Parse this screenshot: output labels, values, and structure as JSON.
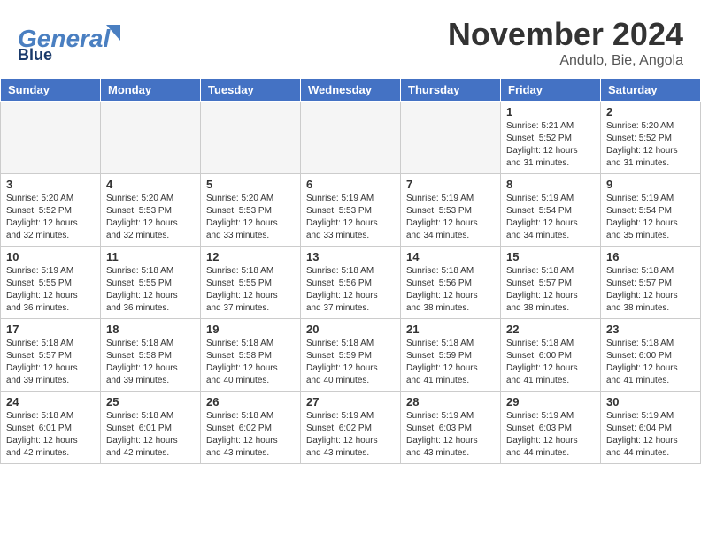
{
  "header": {
    "logo_general": "General",
    "logo_blue": "Blue",
    "month_title": "November 2024",
    "location": "Andulo, Bie, Angola"
  },
  "days_of_week": [
    "Sunday",
    "Monday",
    "Tuesday",
    "Wednesday",
    "Thursday",
    "Friday",
    "Saturday"
  ],
  "weeks": [
    [
      {
        "day": "",
        "info": "",
        "empty": true
      },
      {
        "day": "",
        "info": "",
        "empty": true
      },
      {
        "day": "",
        "info": "",
        "empty": true
      },
      {
        "day": "",
        "info": "",
        "empty": true
      },
      {
        "day": "",
        "info": "",
        "empty": true
      },
      {
        "day": "1",
        "info": "Sunrise: 5:21 AM\nSunset: 5:52 PM\nDaylight: 12 hours\nand 31 minutes."
      },
      {
        "day": "2",
        "info": "Sunrise: 5:20 AM\nSunset: 5:52 PM\nDaylight: 12 hours\nand 31 minutes."
      }
    ],
    [
      {
        "day": "3",
        "info": "Sunrise: 5:20 AM\nSunset: 5:52 PM\nDaylight: 12 hours\nand 32 minutes."
      },
      {
        "day": "4",
        "info": "Sunrise: 5:20 AM\nSunset: 5:53 PM\nDaylight: 12 hours\nand 32 minutes."
      },
      {
        "day": "5",
        "info": "Sunrise: 5:20 AM\nSunset: 5:53 PM\nDaylight: 12 hours\nand 33 minutes."
      },
      {
        "day": "6",
        "info": "Sunrise: 5:19 AM\nSunset: 5:53 PM\nDaylight: 12 hours\nand 33 minutes."
      },
      {
        "day": "7",
        "info": "Sunrise: 5:19 AM\nSunset: 5:53 PM\nDaylight: 12 hours\nand 34 minutes."
      },
      {
        "day": "8",
        "info": "Sunrise: 5:19 AM\nSunset: 5:54 PM\nDaylight: 12 hours\nand 34 minutes."
      },
      {
        "day": "9",
        "info": "Sunrise: 5:19 AM\nSunset: 5:54 PM\nDaylight: 12 hours\nand 35 minutes."
      }
    ],
    [
      {
        "day": "10",
        "info": "Sunrise: 5:19 AM\nSunset: 5:55 PM\nDaylight: 12 hours\nand 36 minutes."
      },
      {
        "day": "11",
        "info": "Sunrise: 5:18 AM\nSunset: 5:55 PM\nDaylight: 12 hours\nand 36 minutes."
      },
      {
        "day": "12",
        "info": "Sunrise: 5:18 AM\nSunset: 5:55 PM\nDaylight: 12 hours\nand 37 minutes."
      },
      {
        "day": "13",
        "info": "Sunrise: 5:18 AM\nSunset: 5:56 PM\nDaylight: 12 hours\nand 37 minutes."
      },
      {
        "day": "14",
        "info": "Sunrise: 5:18 AM\nSunset: 5:56 PM\nDaylight: 12 hours\nand 38 minutes."
      },
      {
        "day": "15",
        "info": "Sunrise: 5:18 AM\nSunset: 5:57 PM\nDaylight: 12 hours\nand 38 minutes."
      },
      {
        "day": "16",
        "info": "Sunrise: 5:18 AM\nSunset: 5:57 PM\nDaylight: 12 hours\nand 38 minutes."
      }
    ],
    [
      {
        "day": "17",
        "info": "Sunrise: 5:18 AM\nSunset: 5:57 PM\nDaylight: 12 hours\nand 39 minutes."
      },
      {
        "day": "18",
        "info": "Sunrise: 5:18 AM\nSunset: 5:58 PM\nDaylight: 12 hours\nand 39 minutes."
      },
      {
        "day": "19",
        "info": "Sunrise: 5:18 AM\nSunset: 5:58 PM\nDaylight: 12 hours\nand 40 minutes."
      },
      {
        "day": "20",
        "info": "Sunrise: 5:18 AM\nSunset: 5:59 PM\nDaylight: 12 hours\nand 40 minutes."
      },
      {
        "day": "21",
        "info": "Sunrise: 5:18 AM\nSunset: 5:59 PM\nDaylight: 12 hours\nand 41 minutes."
      },
      {
        "day": "22",
        "info": "Sunrise: 5:18 AM\nSunset: 6:00 PM\nDaylight: 12 hours\nand 41 minutes."
      },
      {
        "day": "23",
        "info": "Sunrise: 5:18 AM\nSunset: 6:00 PM\nDaylight: 12 hours\nand 41 minutes."
      }
    ],
    [
      {
        "day": "24",
        "info": "Sunrise: 5:18 AM\nSunset: 6:01 PM\nDaylight: 12 hours\nand 42 minutes."
      },
      {
        "day": "25",
        "info": "Sunrise: 5:18 AM\nSunset: 6:01 PM\nDaylight: 12 hours\nand 42 minutes."
      },
      {
        "day": "26",
        "info": "Sunrise: 5:18 AM\nSunset: 6:02 PM\nDaylight: 12 hours\nand 43 minutes."
      },
      {
        "day": "27",
        "info": "Sunrise: 5:19 AM\nSunset: 6:02 PM\nDaylight: 12 hours\nand 43 minutes."
      },
      {
        "day": "28",
        "info": "Sunrise: 5:19 AM\nSunset: 6:03 PM\nDaylight: 12 hours\nand 43 minutes."
      },
      {
        "day": "29",
        "info": "Sunrise: 5:19 AM\nSunset: 6:03 PM\nDaylight: 12 hours\nand 44 minutes."
      },
      {
        "day": "30",
        "info": "Sunrise: 5:19 AM\nSunset: 6:04 PM\nDaylight: 12 hours\nand 44 minutes."
      }
    ]
  ]
}
